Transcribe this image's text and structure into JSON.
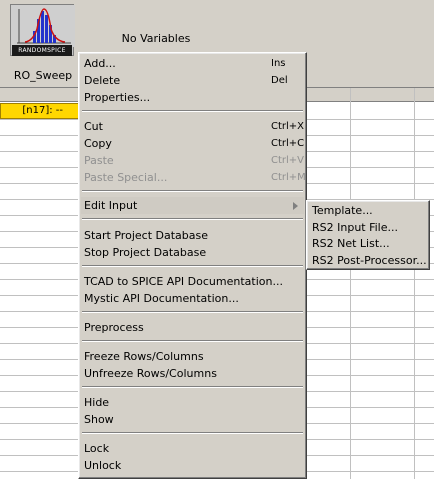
{
  "sheet": {
    "tool_icon_label": "RANDOMSPICE",
    "tool_name": "RO_Sweep",
    "no_variables": "No Variables",
    "selected_cell": "[n17]: --"
  },
  "context_menu": {
    "items": [
      {
        "label": "Add...",
        "shortcut": "Ins"
      },
      {
        "label": "Delete",
        "shortcut": "Del"
      },
      {
        "label": "Properties...",
        "shortcut": ""
      },
      {
        "label": "Cut",
        "shortcut": "Ctrl+X"
      },
      {
        "label": "Copy",
        "shortcut": "Ctrl+C"
      },
      {
        "label": "Paste",
        "shortcut": "Ctrl+V",
        "disabled": true
      },
      {
        "label": "Paste Special...",
        "shortcut": "Ctrl+M",
        "disabled": true
      },
      {
        "label": "Edit Input",
        "shortcut": ""
      },
      {
        "label": "Start Project Database",
        "shortcut": ""
      },
      {
        "label": "Stop Project Database",
        "shortcut": ""
      },
      {
        "label": "TCAD to SPICE API Documentation...",
        "shortcut": ""
      },
      {
        "label": "Mystic API Documentation...",
        "shortcut": ""
      },
      {
        "label": "Preprocess",
        "shortcut": ""
      },
      {
        "label": "Freeze Rows/Columns",
        "shortcut": ""
      },
      {
        "label": "Unfreeze Rows/Columns",
        "shortcut": ""
      },
      {
        "label": "Hide",
        "shortcut": ""
      },
      {
        "label": "Show",
        "shortcut": ""
      },
      {
        "label": "Lock",
        "shortcut": ""
      },
      {
        "label": "Unlock",
        "shortcut": ""
      }
    ]
  },
  "submenu": {
    "items": [
      {
        "label": "Template..."
      },
      {
        "label": "RS2 Input File..."
      },
      {
        "label": "RS2 Net List..."
      },
      {
        "label": "RS2 Post-Processor..."
      }
    ]
  },
  "colors": {
    "menu_bg": "#d4d0c8",
    "selected_cell": "#ffd700",
    "histogram_bars": "#2233cc",
    "histogram_curve": "#cc1111"
  }
}
